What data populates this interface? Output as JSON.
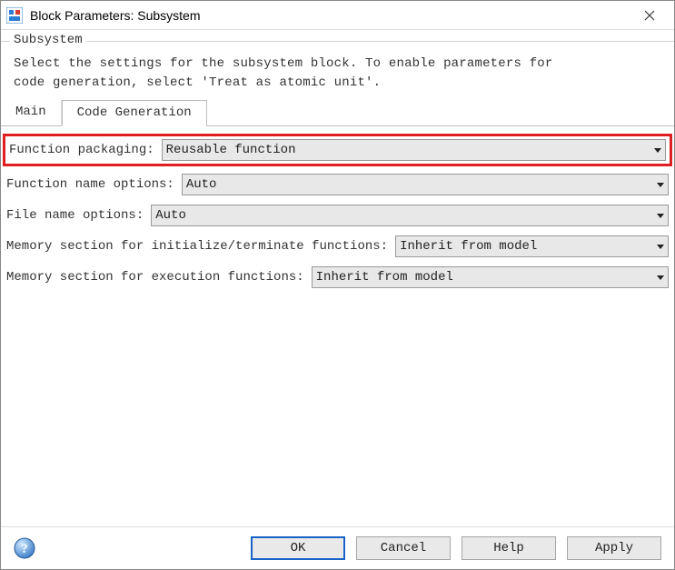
{
  "window": {
    "title": "Block Parameters: Subsystem"
  },
  "group": {
    "title": "Subsystem",
    "description": "Select the settings for the subsystem block. To enable parameters for\ncode generation, select 'Treat as atomic unit'."
  },
  "tabs": {
    "main": "Main",
    "code_gen": "Code Generation"
  },
  "fields": {
    "function_packaging": {
      "label": "Function packaging:",
      "value": "Reusable function"
    },
    "function_name_options": {
      "label": "Function name options:",
      "value": "Auto"
    },
    "file_name_options": {
      "label": "File name options:",
      "value": "Auto"
    },
    "mem_init": {
      "label": "Memory section for initialize/terminate functions:",
      "value": "Inherit from model"
    },
    "mem_exec": {
      "label": "Memory section for execution functions:",
      "value": "Inherit from model"
    }
  },
  "buttons": {
    "ok": "OK",
    "cancel": "Cancel",
    "help": "Help",
    "apply": "Apply"
  }
}
